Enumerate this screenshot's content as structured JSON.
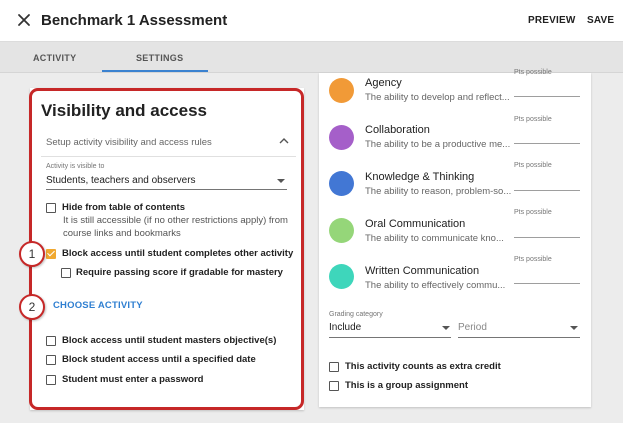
{
  "header": {
    "title": "Benchmark 1 Assessment",
    "preview_label": "PREVIEW",
    "save_label": "SAVE"
  },
  "tabs": [
    {
      "label": "ACTIVITY",
      "active": false
    },
    {
      "label": "SETTINGS",
      "active": true
    }
  ],
  "visibility": {
    "heading": "Visibility and access",
    "section_toggle_label": "Setup activity visibility and access rules",
    "visible_to_label": "Activity is visible to",
    "visible_to_value": "Students, teachers and observers",
    "options": [
      {
        "label": "Hide from table of contents",
        "checked": false,
        "help": "It is still accessible (if no other restrictions apply) from course links and bookmarks"
      },
      {
        "label": "Block access until student completes other activity",
        "checked": true
      },
      {
        "label": "Require passing score if gradable for mastery",
        "checked": false
      },
      {
        "label": "Block access until student masters objective(s)",
        "checked": false
      },
      {
        "label": "Block student access until a specified date",
        "checked": false
      },
      {
        "label": "Student must enter a password",
        "checked": false
      }
    ],
    "choose_activity_label": "CHOOSE ACTIVITY"
  },
  "callouts": [
    "1",
    "2"
  ],
  "objectives": [
    {
      "name": "Agency",
      "desc": "The ability to develop and reflect...",
      "pts_label": "Pts possible",
      "color": "#f19a37"
    },
    {
      "name": "Collaboration",
      "desc": "The ability to be a productive me...",
      "pts_label": "Pts possible",
      "color": "#a55fc9"
    },
    {
      "name": "Knowledge & Thinking",
      "desc": "The ability to reason, problem-so...",
      "pts_label": "Pts possible",
      "color": "#4277d4"
    },
    {
      "name": "Oral Communication",
      "desc": "The ability to communicate kno...",
      "pts_label": "Pts possible",
      "color": "#95d679"
    },
    {
      "name": "Written Communication",
      "desc": "The ability to effectively commu...",
      "pts_label": "Pts possible",
      "color": "#3ed6bb"
    }
  ],
  "grading": {
    "category_label": "Grading category",
    "category_value": "Include",
    "period_placeholder": "Period"
  },
  "extra_options": [
    {
      "label": "This activity counts as extra credit",
      "checked": false
    },
    {
      "label": "This is a group assignment",
      "checked": false
    }
  ],
  "colors": {
    "accent": "#3b82d0",
    "highlight": "#c62828",
    "checkbox_on": "#f0a830"
  }
}
